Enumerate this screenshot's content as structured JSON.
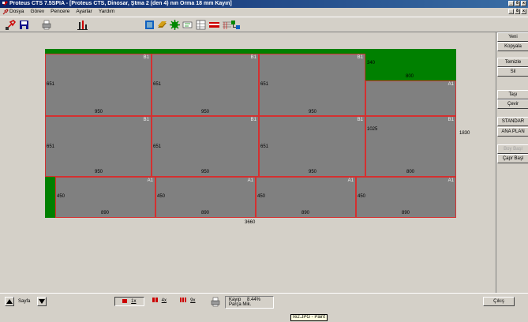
{
  "window": {
    "title": "Proteus CTS 7.5SPIA - [Proteus CTS, Dinosar, Ştma 2 (den 4) nın Orma 18 mm Kayın]",
    "controls": [
      "_",
      "8",
      "x"
    ],
    "doc_controls": [
      "_",
      "8",
      "x"
    ]
  },
  "menu": {
    "items": [
      "Dosya",
      "Görev",
      "Pencere",
      "Ayarlar",
      "Yardım"
    ]
  },
  "layout": {
    "sheet_width": "3660",
    "sheet_height": "1830",
    "green_strip_label": "340",
    "green_strip_width": "800",
    "rows": [
      {
        "panels": [
          {
            "tag": "B1",
            "height": "651",
            "width": "950"
          },
          {
            "tag": "B1",
            "height": "651",
            "width": "950"
          },
          {
            "tag": "B1",
            "height": "651",
            "width": "950"
          },
          {
            "tag": "A1",
            "height": "",
            "width": ""
          }
        ]
      },
      {
        "panels": [
          {
            "tag": "B1",
            "height": "651",
            "width": "950"
          },
          {
            "tag": "B1",
            "height": "651",
            "width": "950"
          },
          {
            "tag": "B1",
            "height": "651",
            "width": "950"
          },
          {
            "tag": "B1",
            "height": "1025",
            "width": "800"
          }
        ]
      },
      {
        "panels": [
          {
            "tag": "A1",
            "height": "450",
            "width": "890"
          },
          {
            "tag": "A1",
            "height": "450",
            "width": "890"
          },
          {
            "tag": "A1",
            "height": "450",
            "width": "890"
          },
          {
            "tag": "A1",
            "height": "450",
            "width": "890"
          }
        ]
      }
    ]
  },
  "right_panel": {
    "buttons": [
      "Yeni",
      "Kopyala",
      "Temizle",
      "Sil",
      "Taşı",
      "Çevir",
      "STANDAR",
      "ANA PLAN",
      "Boy Başl",
      "Çapr Başl"
    ]
  },
  "status": {
    "page_label": "Sayfa",
    "zoom_1": "1x",
    "zoom_4": "4x",
    "zoom_9": "9x",
    "waste_label": "Kayıp",
    "waste_value": "8.44%",
    "parts_label": "Parça Mik.",
    "exit_label": "Çıkış",
    "tooltip": "re2.JPG - Paint"
  },
  "colors": {
    "title": "#0a246a",
    "sheet": "#808080",
    "grain": "#008000",
    "cut_line": "#d43030",
    "face": "#d4d0c8"
  },
  "icons": [
    "app-icon",
    "cut-icon",
    "save-icon",
    "print-icon",
    "chart-icon",
    "stock-icon",
    "material-icon",
    "gear-icon",
    "label-icon",
    "grid-icon",
    "edge-icon",
    "report-icon",
    "network-icon"
  ]
}
